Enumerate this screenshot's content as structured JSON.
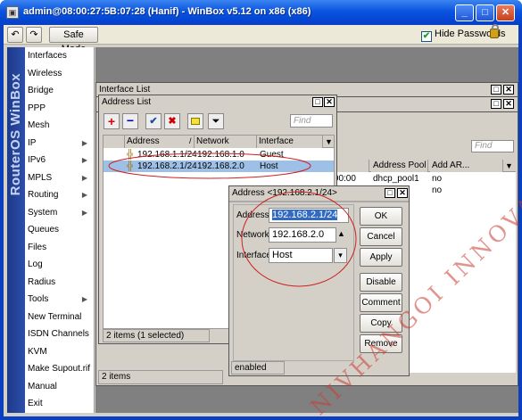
{
  "window": {
    "title": "admin@08:00:27:5B:07:28 (Hanif) - WinBox v5.12 on x86 (x86)",
    "app_icon": "winbox-icon"
  },
  "toolbar": {
    "undo_icon": "undo-icon",
    "redo_icon": "redo-icon",
    "safe_mode_label": "Safe Mode",
    "hide_passwords_label": "Hide Passwords",
    "hide_passwords_checked": true
  },
  "sidebar": {
    "brand": "RouterOS WinBox",
    "items": [
      {
        "label": "Interfaces",
        "submenu": false
      },
      {
        "label": "Wireless",
        "submenu": false
      },
      {
        "label": "Bridge",
        "submenu": false
      },
      {
        "label": "PPP",
        "submenu": false
      },
      {
        "label": "Mesh",
        "submenu": false
      },
      {
        "label": "IP",
        "submenu": true
      },
      {
        "label": "IPv6",
        "submenu": true
      },
      {
        "label": "MPLS",
        "submenu": true
      },
      {
        "label": "Routing",
        "submenu": true
      },
      {
        "label": "System",
        "submenu": true
      },
      {
        "label": "Queues",
        "submenu": false
      },
      {
        "label": "Files",
        "submenu": false
      },
      {
        "label": "Log",
        "submenu": false
      },
      {
        "label": "Radius",
        "submenu": false
      },
      {
        "label": "Tools",
        "submenu": true
      },
      {
        "label": "New Terminal",
        "submenu": false
      },
      {
        "label": "ISDN Channels",
        "submenu": false
      },
      {
        "label": "KVM",
        "submenu": false
      },
      {
        "label": "Make Supout.rif",
        "submenu": false
      },
      {
        "label": "Manual",
        "submenu": false
      },
      {
        "label": "Exit",
        "submenu": false
      }
    ]
  },
  "interface_list": {
    "title": "Interface List",
    "find_placeholder": "Find",
    "columns": [
      "e",
      "Address Pool",
      "Add AR..."
    ],
    "rows": [
      {
        "e": "00:00:00",
        "pool": "dhcp_pool1",
        "add_arp": "no"
      },
      {
        "e": "",
        "pool": "",
        "add_arp": "no"
      }
    ],
    "status": "2 items"
  },
  "address_list": {
    "title": "Address List",
    "find_placeholder": "Find",
    "columns": [
      "Address",
      "Network",
      "Interface"
    ],
    "rows": [
      {
        "address": "192.168.1.1/24",
        "network": "192.168.1.0",
        "interface": "Guest",
        "selected": false
      },
      {
        "address": "192.168.2.1/24",
        "network": "192.168.2.0",
        "interface": "Host",
        "selected": true
      }
    ],
    "status": "2 items (1 selected)",
    "accent": "#9fc0e6"
  },
  "address_dialog": {
    "title": "Address <192.168.2.1/24>",
    "fields": {
      "address_label": "Address:",
      "address_value": "192.168.2.1/24",
      "network_label": "Network:",
      "network_value": "192.168.2.0",
      "interface_label": "Interface:",
      "interface_value": "Host"
    },
    "buttons": {
      "ok": "OK",
      "cancel": "Cancel",
      "apply": "Apply",
      "disable": "Disable",
      "comment": "Comment",
      "copy": "Copy",
      "remove": "Remove"
    },
    "status": "enabled"
  },
  "watermark": "NIVHANGOI INNOVAT.ION",
  "colors": {
    "xp_blue": "#0a54e0",
    "highlight": "#9fc0e6",
    "field_select": "#316ac5",
    "annotation_red": "#cc2020"
  }
}
